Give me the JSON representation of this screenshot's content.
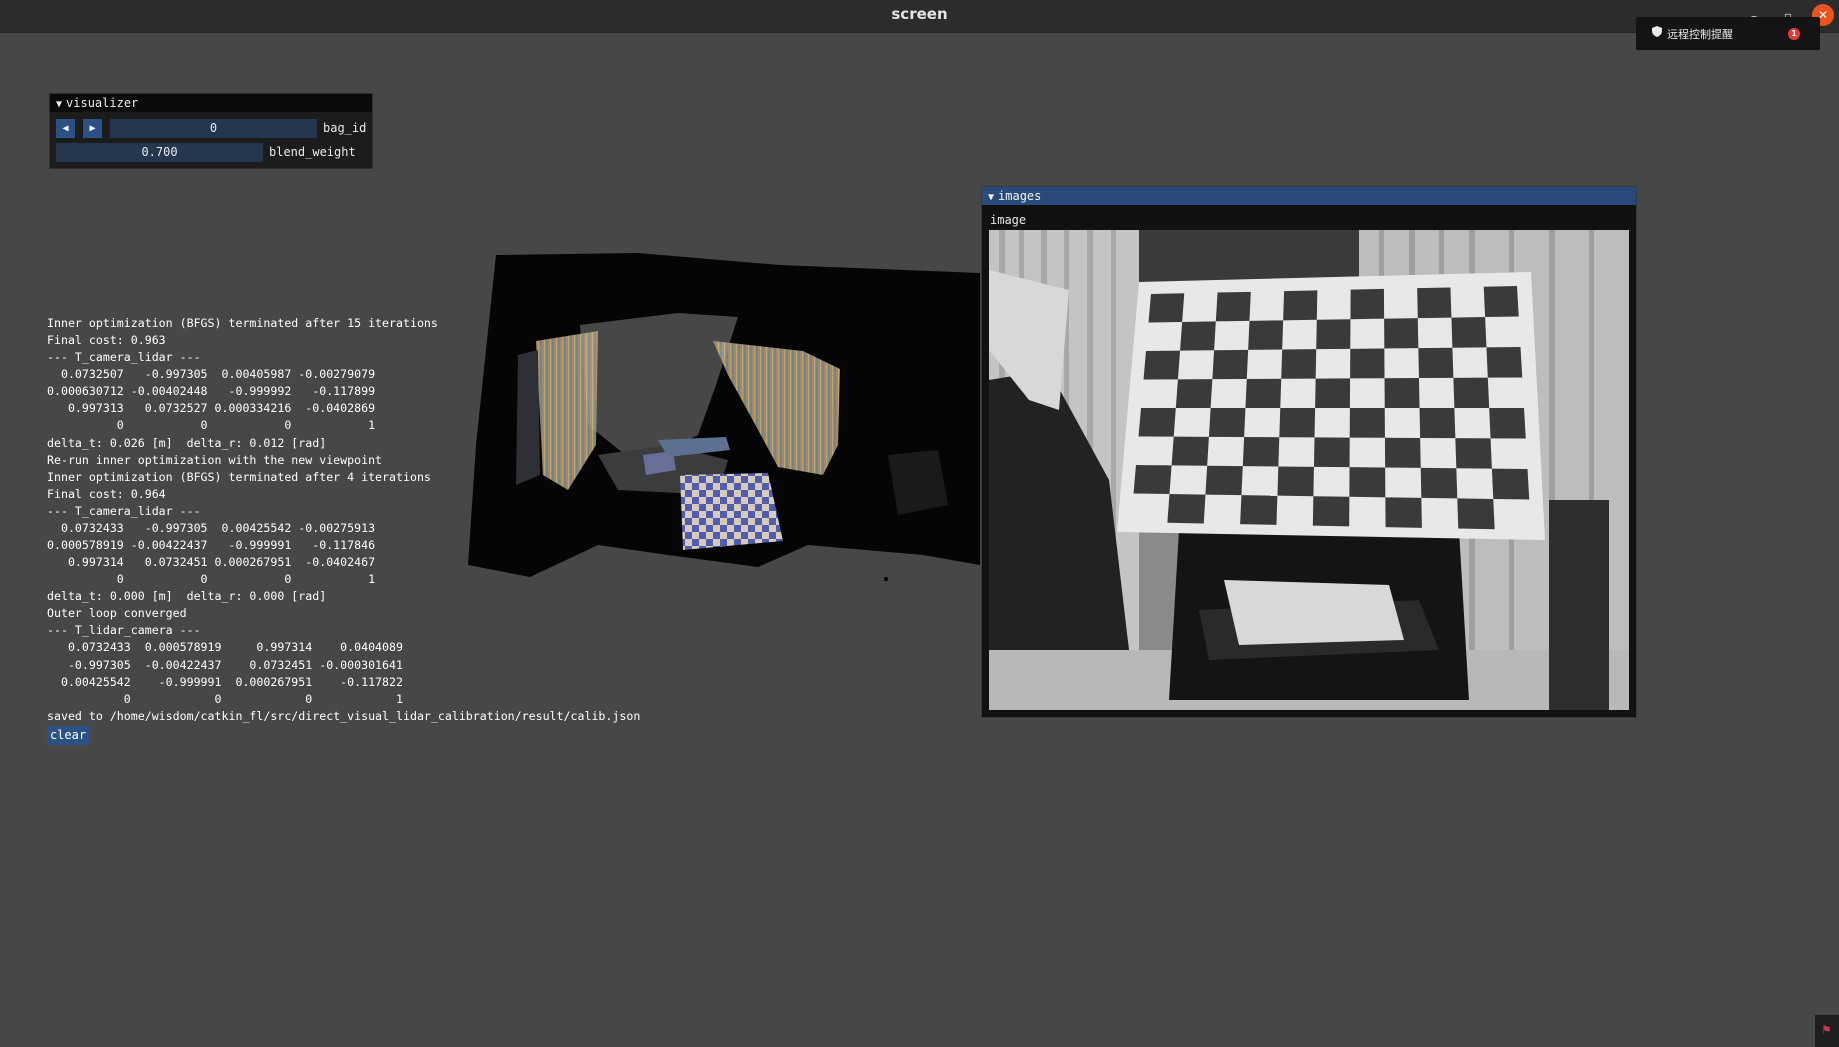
{
  "window": {
    "title": "screen",
    "minimize_label": "–",
    "maximize_label": "▫",
    "close_label": "✕"
  },
  "notification": {
    "icon": "shield-icon",
    "label": "远程控制提醒",
    "badge": "1"
  },
  "visualizer": {
    "title": "visualizer",
    "bag_id": {
      "value": "0",
      "label": "bag_id"
    },
    "blend_weight": {
      "value": "0.700",
      "label": "blend_weight"
    },
    "prev_label": "◀",
    "next_label": "▶"
  },
  "log": {
    "lines": [
      "Inner optimization (BFGS) terminated after 15 iterations",
      "Final cost: 0.963",
      "--- T_camera_lidar ---",
      "  0.0732507   -0.997305  0.00405987 -0.00279079",
      "0.000630712 -0.00402448   -0.999992   -0.117899",
      "   0.997313   0.0732527 0.000334216  -0.0402869",
      "          0           0           0           1",
      "delta_t: 0.026 [m]  delta_r: 0.012 [rad]",
      "Re-run inner optimization with the new viewpoint",
      "Inner optimization (BFGS) terminated after 4 iterations",
      "Final cost: 0.964",
      "--- T_camera_lidar ---",
      "  0.0732433   -0.997305  0.00425542 -0.00275913",
      "0.000578919 -0.00422437   -0.999991   -0.117846",
      "   0.997314   0.0732451 0.000267951  -0.0402467",
      "          0           0           0           1",
      "delta_t: 0.000 [m]  delta_r: 0.000 [rad]",
      "Outer loop converged",
      "--- T_lidar_camera ---",
      "   0.0732433  0.000578919     0.997314    0.0404089",
      "   -0.997305  -0.00422437    0.0732451 -0.000301641",
      "  0.00425542    -0.999991  0.000267951    -0.117822",
      "           0            0            0            1",
      "saved to /home/wisdom/catkin_fl/src/direct_visual_lidar_calibration/result/calib.json"
    ],
    "clear_label": "clear"
  },
  "images": {
    "title": "images",
    "image_label": "image"
  }
}
